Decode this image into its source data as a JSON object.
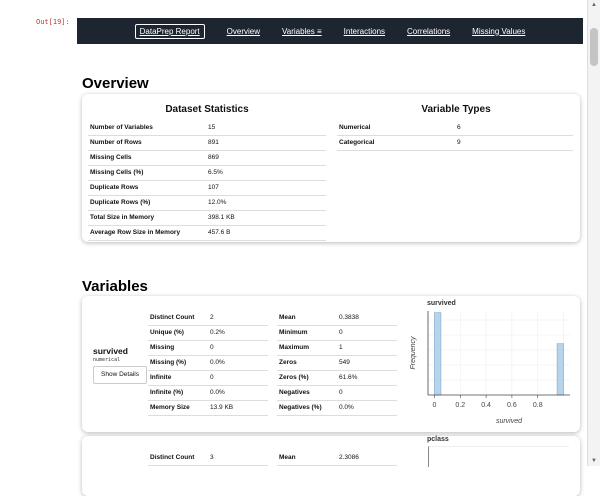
{
  "cell": {
    "prompt": "Out[19]:"
  },
  "navbar": {
    "brand": "DataPrep Report",
    "items": [
      "Overview",
      "Variables ≡",
      "Interactions",
      "Correlations",
      "Missing Values"
    ]
  },
  "overview": {
    "title": "Overview",
    "dataset_stats": {
      "title": "Dataset Statistics",
      "rows": [
        {
          "label": "Number of Variables",
          "value": "15"
        },
        {
          "label": "Number of Rows",
          "value": "891"
        },
        {
          "label": "Missing Cells",
          "value": "869"
        },
        {
          "label": "Missing Cells (%)",
          "value": "6.5%"
        },
        {
          "label": "Duplicate Rows",
          "value": "107"
        },
        {
          "label": "Duplicate Rows (%)",
          "value": "12.0%"
        },
        {
          "label": "Total Size in Memory",
          "value": "398.1 KB"
        },
        {
          "label": "Average Row Size in Memory",
          "value": "457.6 B"
        }
      ]
    },
    "variable_types": {
      "title": "Variable Types",
      "rows": [
        {
          "label": "Numerical",
          "value": "6"
        },
        {
          "label": "Categorical",
          "value": "9"
        }
      ]
    }
  },
  "variables": {
    "title": "Variables",
    "survived": {
      "name": "survived",
      "type": "numerical",
      "button": "Show Details",
      "left_stats": [
        {
          "label": "Distinct Count",
          "value": "2"
        },
        {
          "label": "Unique (%)",
          "value": "0.2%"
        },
        {
          "label": "Missing",
          "value": "0"
        },
        {
          "label": "Missing (%)",
          "value": "0.0%"
        },
        {
          "label": "Infinite",
          "value": "0"
        },
        {
          "label": "Infinite (%)",
          "value": "0.0%"
        },
        {
          "label": "Memory Size",
          "value": "13.9 KB"
        }
      ],
      "right_stats": [
        {
          "label": "Mean",
          "value": "0.3838"
        },
        {
          "label": "Minimum",
          "value": "0"
        },
        {
          "label": "Maximum",
          "value": "1"
        },
        {
          "label": "Zeros",
          "value": "549"
        },
        {
          "label": "Zeros (%)",
          "value": "61.6%"
        },
        {
          "label": "Negatives",
          "value": "0"
        },
        {
          "label": "Negatives (%)",
          "value": "0.0%"
        }
      ]
    },
    "pclass": {
      "left_stats": [
        {
          "label": "Distinct Count",
          "value": "3"
        }
      ],
      "right_stats": [
        {
          "label": "Mean",
          "value": "2.3086"
        }
      ],
      "plot_title": "pclass"
    }
  },
  "chart_data": [
    {
      "type": "bar",
      "title": "survived",
      "xlabel": "survived",
      "ylabel": "Frequency",
      "x_ticks": [
        "0",
        "0.2",
        "0.4",
        "0.6",
        "0.8"
      ],
      "xlim": [
        -0.05,
        1.05
      ],
      "ylim": [
        0,
        560
      ],
      "bins": [
        {
          "x0": 0.0,
          "x1": 0.05,
          "count": 549
        },
        {
          "x0": 0.95,
          "x1": 1.0,
          "count": 342
        }
      ],
      "bar_color": "#b8d4ea",
      "bar_stroke": "#7fa9cc"
    }
  ]
}
